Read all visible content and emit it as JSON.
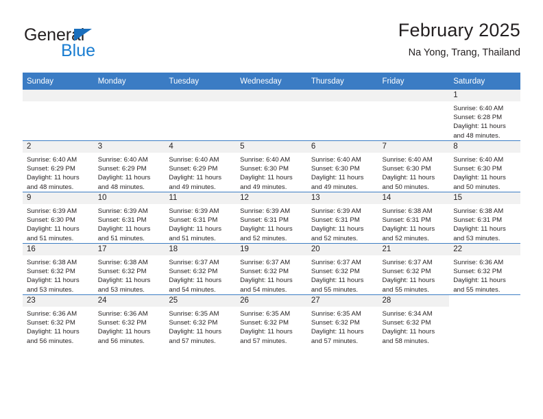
{
  "logo": {
    "text_primary": "General",
    "text_secondary": "Blue",
    "triangle_color": "#1a6fbd",
    "secondary_color": "#1a7dd1"
  },
  "header": {
    "title": "February 2025",
    "subtitle": "Na Yong, Trang, Thailand"
  },
  "theme": {
    "header_bg": "#3b7cc4",
    "daynum_bg": "#f1f1f1",
    "text": "#231f20",
    "row_divider": "#3b7cc4"
  },
  "calendar": {
    "weekday_headers": [
      "Sunday",
      "Monday",
      "Tuesday",
      "Wednesday",
      "Thursday",
      "Friday",
      "Saturday"
    ],
    "labels": {
      "sunrise": "Sunrise:",
      "sunset": "Sunset:",
      "daylight": "Daylight:"
    },
    "weeks": [
      [
        {
          "day": "",
          "empty": true
        },
        {
          "day": "",
          "empty": true
        },
        {
          "day": "",
          "empty": true
        },
        {
          "day": "",
          "empty": true
        },
        {
          "day": "",
          "empty": true
        },
        {
          "day": "",
          "empty": true
        },
        {
          "day": "1",
          "sunrise": "Sunrise: 6:40 AM",
          "sunset": "Sunset: 6:28 PM",
          "daylight_line1": "Daylight: 11 hours",
          "daylight_line2": "and 48 minutes."
        }
      ],
      [
        {
          "day": "2",
          "sunrise": "Sunrise: 6:40 AM",
          "sunset": "Sunset: 6:29 PM",
          "daylight_line1": "Daylight: 11 hours",
          "daylight_line2": "and 48 minutes."
        },
        {
          "day": "3",
          "sunrise": "Sunrise: 6:40 AM",
          "sunset": "Sunset: 6:29 PM",
          "daylight_line1": "Daylight: 11 hours",
          "daylight_line2": "and 48 minutes."
        },
        {
          "day": "4",
          "sunrise": "Sunrise: 6:40 AM",
          "sunset": "Sunset: 6:29 PM",
          "daylight_line1": "Daylight: 11 hours",
          "daylight_line2": "and 49 minutes."
        },
        {
          "day": "5",
          "sunrise": "Sunrise: 6:40 AM",
          "sunset": "Sunset: 6:30 PM",
          "daylight_line1": "Daylight: 11 hours",
          "daylight_line2": "and 49 minutes."
        },
        {
          "day": "6",
          "sunrise": "Sunrise: 6:40 AM",
          "sunset": "Sunset: 6:30 PM",
          "daylight_line1": "Daylight: 11 hours",
          "daylight_line2": "and 49 minutes."
        },
        {
          "day": "7",
          "sunrise": "Sunrise: 6:40 AM",
          "sunset": "Sunset: 6:30 PM",
          "daylight_line1": "Daylight: 11 hours",
          "daylight_line2": "and 50 minutes."
        },
        {
          "day": "8",
          "sunrise": "Sunrise: 6:40 AM",
          "sunset": "Sunset: 6:30 PM",
          "daylight_line1": "Daylight: 11 hours",
          "daylight_line2": "and 50 minutes."
        }
      ],
      [
        {
          "day": "9",
          "sunrise": "Sunrise: 6:39 AM",
          "sunset": "Sunset: 6:30 PM",
          "daylight_line1": "Daylight: 11 hours",
          "daylight_line2": "and 51 minutes."
        },
        {
          "day": "10",
          "sunrise": "Sunrise: 6:39 AM",
          "sunset": "Sunset: 6:31 PM",
          "daylight_line1": "Daylight: 11 hours",
          "daylight_line2": "and 51 minutes."
        },
        {
          "day": "11",
          "sunrise": "Sunrise: 6:39 AM",
          "sunset": "Sunset: 6:31 PM",
          "daylight_line1": "Daylight: 11 hours",
          "daylight_line2": "and 51 minutes."
        },
        {
          "day": "12",
          "sunrise": "Sunrise: 6:39 AM",
          "sunset": "Sunset: 6:31 PM",
          "daylight_line1": "Daylight: 11 hours",
          "daylight_line2": "and 52 minutes."
        },
        {
          "day": "13",
          "sunrise": "Sunrise: 6:39 AM",
          "sunset": "Sunset: 6:31 PM",
          "daylight_line1": "Daylight: 11 hours",
          "daylight_line2": "and 52 minutes."
        },
        {
          "day": "14",
          "sunrise": "Sunrise: 6:38 AM",
          "sunset": "Sunset: 6:31 PM",
          "daylight_line1": "Daylight: 11 hours",
          "daylight_line2": "and 52 minutes."
        },
        {
          "day": "15",
          "sunrise": "Sunrise: 6:38 AM",
          "sunset": "Sunset: 6:31 PM",
          "daylight_line1": "Daylight: 11 hours",
          "daylight_line2": "and 53 minutes."
        }
      ],
      [
        {
          "day": "16",
          "sunrise": "Sunrise: 6:38 AM",
          "sunset": "Sunset: 6:32 PM",
          "daylight_line1": "Daylight: 11 hours",
          "daylight_line2": "and 53 minutes."
        },
        {
          "day": "17",
          "sunrise": "Sunrise: 6:38 AM",
          "sunset": "Sunset: 6:32 PM",
          "daylight_line1": "Daylight: 11 hours",
          "daylight_line2": "and 53 minutes."
        },
        {
          "day": "18",
          "sunrise": "Sunrise: 6:37 AM",
          "sunset": "Sunset: 6:32 PM",
          "daylight_line1": "Daylight: 11 hours",
          "daylight_line2": "and 54 minutes."
        },
        {
          "day": "19",
          "sunrise": "Sunrise: 6:37 AM",
          "sunset": "Sunset: 6:32 PM",
          "daylight_line1": "Daylight: 11 hours",
          "daylight_line2": "and 54 minutes."
        },
        {
          "day": "20",
          "sunrise": "Sunrise: 6:37 AM",
          "sunset": "Sunset: 6:32 PM",
          "daylight_line1": "Daylight: 11 hours",
          "daylight_line2": "and 55 minutes."
        },
        {
          "day": "21",
          "sunrise": "Sunrise: 6:37 AM",
          "sunset": "Sunset: 6:32 PM",
          "daylight_line1": "Daylight: 11 hours",
          "daylight_line2": "and 55 minutes."
        },
        {
          "day": "22",
          "sunrise": "Sunrise: 6:36 AM",
          "sunset": "Sunset: 6:32 PM",
          "daylight_line1": "Daylight: 11 hours",
          "daylight_line2": "and 55 minutes."
        }
      ],
      [
        {
          "day": "23",
          "sunrise": "Sunrise: 6:36 AM",
          "sunset": "Sunset: 6:32 PM",
          "daylight_line1": "Daylight: 11 hours",
          "daylight_line2": "and 56 minutes."
        },
        {
          "day": "24",
          "sunrise": "Sunrise: 6:36 AM",
          "sunset": "Sunset: 6:32 PM",
          "daylight_line1": "Daylight: 11 hours",
          "daylight_line2": "and 56 minutes."
        },
        {
          "day": "25",
          "sunrise": "Sunrise: 6:35 AM",
          "sunset": "Sunset: 6:32 PM",
          "daylight_line1": "Daylight: 11 hours",
          "daylight_line2": "and 57 minutes."
        },
        {
          "day": "26",
          "sunrise": "Sunrise: 6:35 AM",
          "sunset": "Sunset: 6:32 PM",
          "daylight_line1": "Daylight: 11 hours",
          "daylight_line2": "and 57 minutes."
        },
        {
          "day": "27",
          "sunrise": "Sunrise: 6:35 AM",
          "sunset": "Sunset: 6:32 PM",
          "daylight_line1": "Daylight: 11 hours",
          "daylight_line2": "and 57 minutes."
        },
        {
          "day": "28",
          "sunrise": "Sunrise: 6:34 AM",
          "sunset": "Sunset: 6:32 PM",
          "daylight_line1": "Daylight: 11 hours",
          "daylight_line2": "and 58 minutes."
        },
        {
          "day": "",
          "empty": true,
          "no_band": true
        }
      ]
    ]
  }
}
